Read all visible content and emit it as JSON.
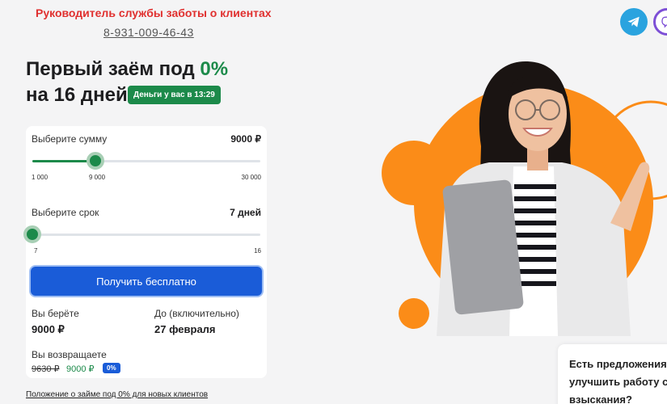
{
  "support": {
    "role": "Руководитель службы заботы о клиентах",
    "phone": "8-931-009-46-43"
  },
  "social": [
    {
      "icon": "telegram-icon",
      "color": "#2aa3df"
    },
    {
      "icon": "viber-icon",
      "color": "#7d4fd6"
    }
  ],
  "headline": {
    "line1_prefix": "Первый заём под ",
    "line1_accent": "0%",
    "line2": "на 16 дней",
    "time_badge": "Деньги у вас в 13:29",
    "accent_color": "#1c8a4a"
  },
  "calculator": {
    "amount": {
      "label": "Выберите сумму",
      "value": "9000 ₽",
      "min": 1000,
      "max": 30000,
      "current": 9000,
      "ticks": [
        "1 000",
        "9 000",
        "30 000"
      ]
    },
    "term": {
      "label": "Выберите срок",
      "value": "7 дней",
      "min": 7,
      "max": 16,
      "current": 7,
      "ticks": [
        "7",
        "16"
      ]
    },
    "cta_label": "Получить бесплатно",
    "cta_color": "#1a5cd8",
    "summary": {
      "take_label": "Вы берёте",
      "take_value": "9000 ₽",
      "until_label": "До (включительно)",
      "until_value": "27 февраля",
      "return_label": "Вы возвращаете",
      "old_price": "9630 ₽",
      "new_price": "9000 ₽",
      "rate_badge": "0%"
    }
  },
  "footnote": "Положение о займе под 0% для новых клиентов",
  "offer": {
    "line1": "Есть предложения",
    "line2": "улучшить работу с",
    "line3": "взыскания?"
  }
}
